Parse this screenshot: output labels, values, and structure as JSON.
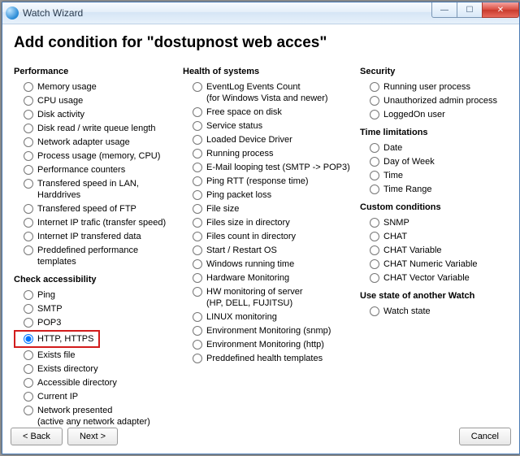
{
  "window": {
    "title": "Watch Wizard"
  },
  "heading": "Add condition for \"dostupnost web acces\"",
  "groups": {
    "performance": {
      "title": "Performance",
      "items": [
        "Memory usage",
        "CPU usage",
        "Disk activity",
        "Disk read / write queue length",
        "Network adapter usage",
        "Process usage (memory, CPU)",
        "Performance counters",
        "Transfered speed in LAN, Harddrives",
        "Transfered speed of FTP",
        "Internet IP trafic (transfer speed)",
        "Internet IP transfered data",
        "Preddefined performance templates"
      ]
    },
    "accessibility": {
      "title": "Check accessibility",
      "items": [
        "Ping",
        "SMTP",
        "POP3",
        "HTTP, HTTPS",
        "Exists file",
        "Exists directory",
        "Accessible directory",
        "Current IP",
        "Network presented\n(active any network adapter)"
      ],
      "selected_index": 3
    },
    "health": {
      "title": "Health of systems",
      "items": [
        "EventLog Events Count\n(for Windows Vista and newer)",
        "Free space on disk",
        "Service status",
        "Loaded Device Driver",
        "Running process",
        "E-Mail looping test (SMTP -> POP3)",
        "Ping RTT (response time)",
        "Ping packet loss",
        "File size",
        "Files size in directory",
        "Files count in directory",
        "Start / Restart OS",
        "Windows running time",
        "Hardware Monitoring",
        "HW monitoring of server\n(HP, DELL, FUJITSU)",
        "LINUX monitoring",
        "Environment Monitoring (snmp)",
        "Environment Monitoring (http)",
        "Preddefined health templates"
      ]
    },
    "security": {
      "title": "Security",
      "items": [
        "Running user process",
        "Unauthorized admin process",
        "LoggedOn user"
      ]
    },
    "time": {
      "title": "Time limitations",
      "items": [
        "Date",
        "Day of Week",
        "Time",
        "Time Range"
      ]
    },
    "custom": {
      "title": "Custom conditions",
      "items": [
        "SNMP",
        "CHAT",
        "CHAT Variable",
        "CHAT Numeric Variable",
        "CHAT Vector Variable"
      ]
    },
    "watch_state": {
      "title": "Use state of another Watch",
      "items": [
        "Watch state"
      ]
    }
  },
  "buttons": {
    "back": "< Back",
    "next": "Next >",
    "cancel": "Cancel"
  }
}
